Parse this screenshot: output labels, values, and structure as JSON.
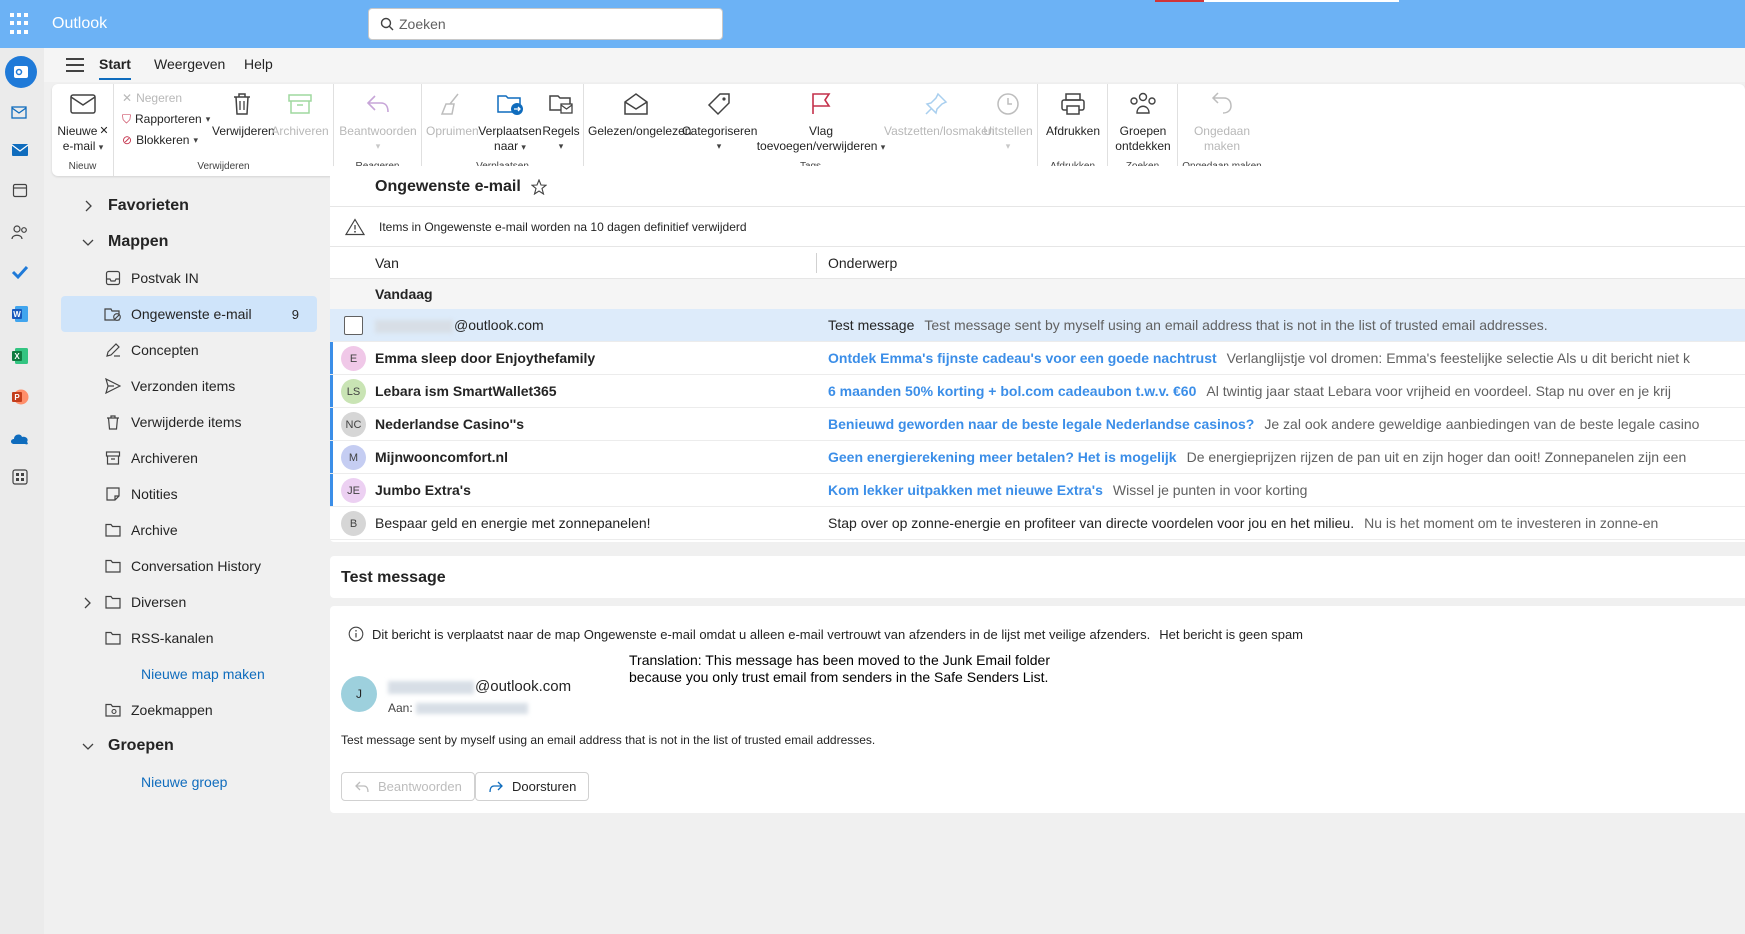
{
  "app": {
    "title": "Outlook"
  },
  "search": {
    "placeholder": "Zoeken"
  },
  "colors": {
    "topbar": "#6cb2f5",
    "accent": "#0f6cbd",
    "selected_folder": "#cfe4fa",
    "selected_row": "#ddebfa",
    "unread_subject": "#3b8ee8"
  },
  "rail": {
    "icons": [
      "outlook-app-icon",
      "mail-send-icon",
      "mail-icon",
      "calendar-icon",
      "people-icon",
      "todo-check-icon",
      "word-icon",
      "excel-icon",
      "powerpoint-icon",
      "onedrive-icon",
      "more-apps-icon"
    ]
  },
  "tabs": {
    "start": "Start",
    "weergeven": "Weergeven",
    "help": "Help"
  },
  "ribbon": {
    "nieuw": {
      "label": "Nieuw",
      "new_mail_line1": "Nieuwe",
      "new_mail_line2": "e-mail"
    },
    "verwijderen": {
      "label": "Verwijderen",
      "negeren": "Negeren",
      "rapporteren": "Rapporteren",
      "blokkeren": "Blokkeren",
      "verwijderen": "Verwijderen",
      "archiveren": "Archiveren"
    },
    "reageren": {
      "label": "Reageren",
      "beantwoorden": "Beantwoorden"
    },
    "verplaatsen": {
      "label": "Verplaatsen",
      "opruimen": "Opruimen",
      "verplaatsen_line1": "Verplaatsen",
      "verplaatsen_line2": "naar",
      "regels": "Regels"
    },
    "tags": {
      "label": "Tags",
      "gelezen": "Gelezen/ongelezen",
      "categoriseren": "Categoriseren",
      "vlag_line1": "Vlag",
      "vlag_line2": "toevoegen/verwijderen",
      "vastzetten": "Vastzetten/losmaken",
      "uitstellen": "Uitstellen"
    },
    "afdrukken": {
      "label": "Afdrukken",
      "afdrukken": "Afdrukken"
    },
    "zoeken": {
      "label": "Zoeken",
      "groepen_line1": "Groepen",
      "groepen_line2": "ontdekken"
    },
    "ongedaan": {
      "label": "Ongedaan maken",
      "line1": "Ongedaan",
      "line2": "maken"
    }
  },
  "folders": {
    "favorieten": "Favorieten",
    "mappen": "Mappen",
    "items": [
      {
        "label": "Postvak IN",
        "icon": "inbox-icon"
      },
      {
        "label": "Ongewenste e-mail",
        "icon": "junk-icon",
        "count": "9"
      },
      {
        "label": "Concepten",
        "icon": "pencil-icon"
      },
      {
        "label": "Verzonden items",
        "icon": "send-icon"
      },
      {
        "label": "Verwijderde items",
        "icon": "trash-icon"
      },
      {
        "label": "Archiveren",
        "icon": "archive-icon"
      },
      {
        "label": "Notities",
        "icon": "note-icon"
      },
      {
        "label": "Archive",
        "icon": "folder-icon"
      },
      {
        "label": "Conversation History",
        "icon": "folder-icon"
      },
      {
        "label": "Diversen",
        "icon": "folder-icon"
      },
      {
        "label": "RSS-kanalen",
        "icon": "folder-icon"
      }
    ],
    "nieuwe_map": "Nieuwe map maken",
    "zoekmappen": "Zoekmappen",
    "groepen": "Groepen",
    "nieuwe_groep": "Nieuwe groep"
  },
  "list": {
    "title": "Ongewenste e-mail",
    "notice": "Items in Ongewenste e-mail worden na 10 dagen definitief verwijderd",
    "col_van": "Van",
    "col_onderwerp": "Onderwerp",
    "day": "Vandaag",
    "rows": [
      {
        "from": "@outlook.com",
        "subject": "Test message",
        "preview": "Test message sent by myself using an email address that is not in the list of trusted email addresses."
      },
      {
        "initials": "E",
        "from": "Emma sleep door Enjoythefamily",
        "subject": "Ontdek Emma's fijnste cadeau's voor een goede nachtrust",
        "preview": "Verlanglijstje vol dromen: Emma's feestelijke selectie Als u dit bericht niet k",
        "avatar_color": "#f0c8e8"
      },
      {
        "initials": "LS",
        "from": "Lebara ism SmartWallet365",
        "subject": "6 maanden 50% korting + bol.com cadeaubon t.w.v. €60",
        "preview": "Al twintig jaar staat Lebara voor vrijheid en voordeel. Stap nu over en je krij",
        "avatar_color": "#c9e4b4"
      },
      {
        "initials": "NC",
        "from": "Nederlandse Casino''s",
        "subject": "Benieuwd geworden naar de beste legale Nederlandse casinos?",
        "preview": "Je zal ook andere geweldige aanbiedingen van de beste legale casino",
        "avatar_color": "#d6d6d6"
      },
      {
        "initials": "M",
        "from": "Mijnwooncomfort.nl",
        "subject": "Geen energierekening meer betalen? Het is mogelijk",
        "preview": "De energieprijzen rijzen de pan uit en zijn hoger dan ooit! Zonnepanelen zijn een",
        "avatar_color": "#c5cdf2"
      },
      {
        "initials": "JE",
        "from": "Jumbo Extra's",
        "subject": "Kom lekker uitpakken met nieuwe Extra's",
        "preview": "Wissel je punten in voor korting",
        "avatar_color": "#ecd0f2"
      },
      {
        "initials": "B",
        "from": "Bespaar geld en energie met zonnepanelen!",
        "subject": "Stap over op zonne-energie en profiteer van directe voordelen voor jou en het milieu.",
        "preview": "Nu is het moment om te investeren in zonne-en",
        "avatar_color": "#d6d6d6"
      }
    ]
  },
  "reading": {
    "subject": "Test message",
    "info": "Dit bericht is verplaatst naar de map Ongewenste e-mail omdat u alleen e-mail vertrouwt van afzenders in de lijst met veilige afzenders.",
    "not_spam": "Het bericht is geen spam",
    "translation_line1": "Translation: This message has been moved to the Junk Email folder",
    "translation_line2": "because you only trust email from senders in the Safe Senders List.",
    "sender_initial": "J",
    "sender": "@outlook.com",
    "to_label": "Aan:",
    "body": "Test message sent by myself using an email address that is not in the list of trusted email addresses.",
    "reply": "Beantwoorden",
    "forward": "Doorsturen"
  }
}
